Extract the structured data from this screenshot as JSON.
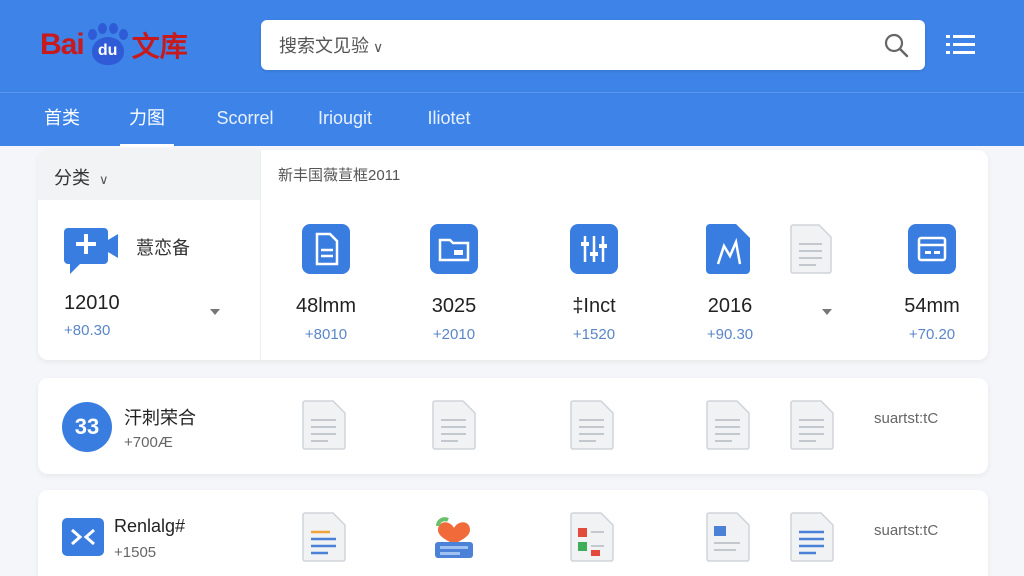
{
  "header": {
    "logo": {
      "latin": "Bai",
      "paw_text": "du",
      "cjk": "文库"
    },
    "search": {
      "placeholder": "搜索文见验",
      "chevron": "∨"
    },
    "colors": {
      "primary": "#3e84e8",
      "logo_red": "#c8191c",
      "logo_blue": "#2f5bd6"
    }
  },
  "nav": {
    "tabs": [
      {
        "label": "首类"
      },
      {
        "label": "力图",
        "active": true
      },
      {
        "label": "Scorrel"
      },
      {
        "label": "Iriougit"
      },
      {
        "label": "Iliotet"
      }
    ]
  },
  "category": {
    "dropdown_label": "分类",
    "dropdown_caret": "∨",
    "title": "新丰国薇荁框2011",
    "first": {
      "label": "薏恋备",
      "value": "12010",
      "delta": "+80.30",
      "icon": "add-video-icon"
    },
    "stats": [
      {
        "value": "48lmm",
        "delta": "+8010",
        "icon": "document-icon"
      },
      {
        "value": "3025",
        "delta": "+2010",
        "icon": "folder-card-icon"
      },
      {
        "value": "‡Inct",
        "delta": "+1520",
        "icon": "equalizer-icon"
      },
      {
        "value": "2016",
        "delta": "+90.30",
        "icon": "pen-document-icon"
      },
      {
        "value": "54mm",
        "delta": "+70.20",
        "icon": "window-icon"
      }
    ]
  },
  "rows": [
    {
      "badge": "33",
      "title": "汗刺荣合",
      "sub": "+700Æ",
      "tag": "suartst:tC",
      "docs": [
        "doc-lines-icon",
        "doc-lines-icon",
        "doc-lines-icon",
        "doc-lines-icon",
        "doc-lines-icon"
      ]
    },
    {
      "title": "Renlalg#",
      "sub": "+1505",
      "tag": "suartst:tC",
      "docs": [
        "doc-color-lines-icon",
        "heart-book-icon",
        "doc-colored-blocks-icon",
        "doc-blue-block-icon",
        "doc-blue-lines-icon"
      ]
    }
  ]
}
